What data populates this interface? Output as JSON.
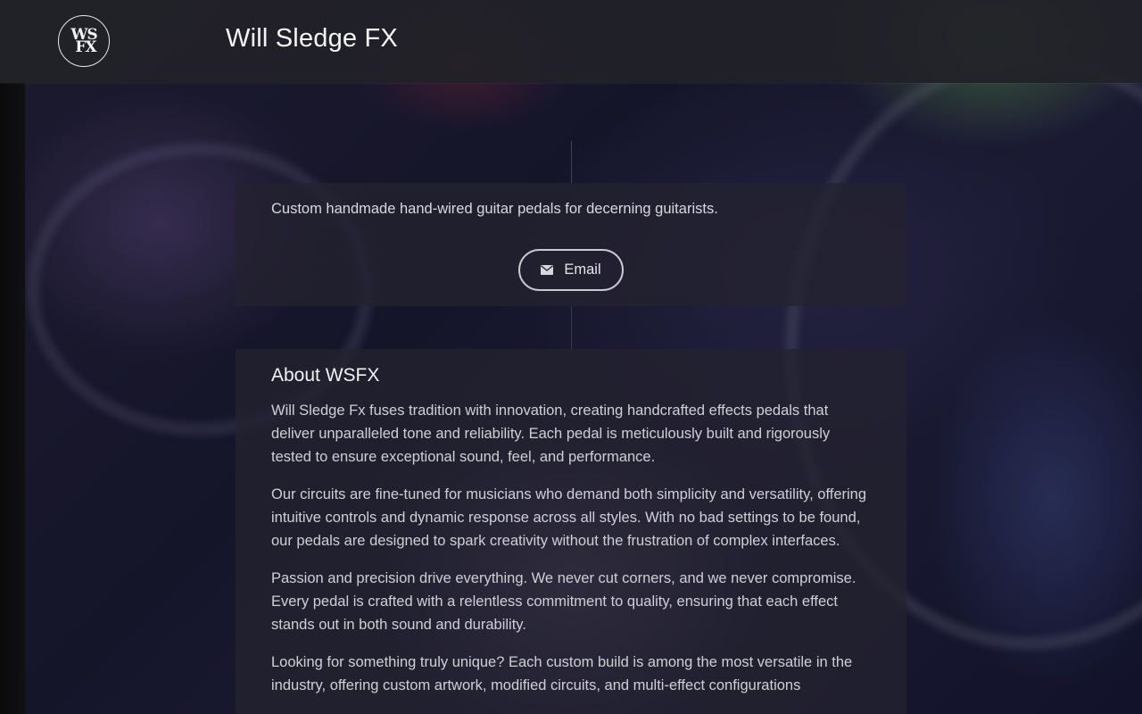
{
  "header": {
    "logo_text_line1": "WS",
    "logo_text_line2": "FX",
    "site_title": "Will Sledge FX"
  },
  "hero": {
    "tagline": "Custom handmade hand-wired guitar pedals for decerning guitarists.",
    "email_button_label": "Email",
    "email_icon": "envelope-icon"
  },
  "about": {
    "heading": "About WSFX",
    "paragraphs": [
      "Will Sledge Fx fuses tradition with innovation, creating handcrafted effects pedals that deliver unparalleled tone and reliability. Each pedal is meticulously built and rigorously tested to ensure exceptional sound, feel, and performance.",
      "Our circuits are fine-tuned for musicians who demand both simplicity and versatility, offering intuitive controls and dynamic response across all styles. With no bad settings to be found, our pedals are designed to spark creativity without the frustration of complex interfaces.",
      "Passion and precision drive everything. We never cut corners, and we never compromise. Every pedal is crafted with a relentless commitment to quality, ensuring that each effect stands out in both sound and durability.",
      "Looking for something truly unique? Each custom build is among the most versatile in the industry, offering custom artwork, modified circuits, and multi-effect configurations"
    ]
  },
  "colors": {
    "header_bg": "#222228",
    "card_bg": "#242330",
    "text": "#cfcfd6",
    "title": "#f4f4f6"
  }
}
